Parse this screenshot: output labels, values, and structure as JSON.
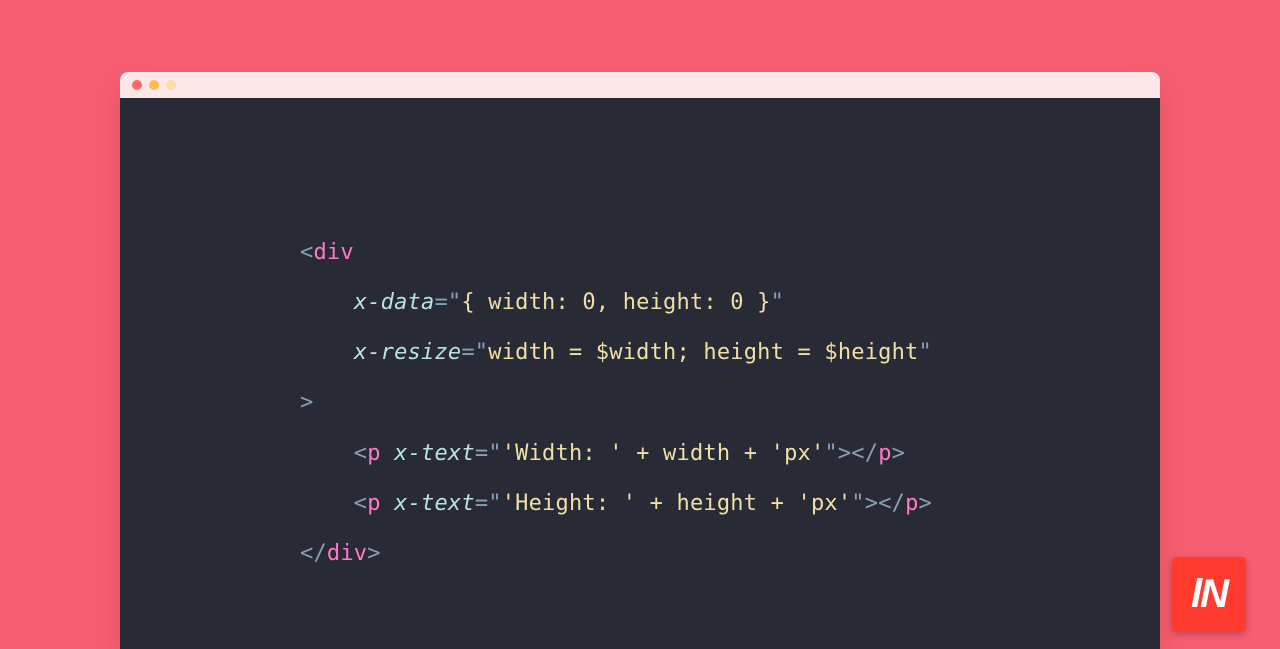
{
  "logo": {
    "text": "lN"
  },
  "code": {
    "lines": [
      {
        "tokens": [
          {
            "cls": "tok-punc",
            "t": "<"
          },
          {
            "cls": "tok-tag",
            "t": "div"
          }
        ]
      },
      {
        "indent": 1,
        "tokens": [
          {
            "cls": "tok-attr",
            "t": "x-data"
          },
          {
            "cls": "tok-eq",
            "t": "="
          },
          {
            "cls": "tok-quote",
            "t": "\""
          },
          {
            "cls": "tok-str",
            "t": "{ width: 0, height: 0 }"
          },
          {
            "cls": "tok-quote",
            "t": "\""
          }
        ]
      },
      {
        "indent": 1,
        "tokens": [
          {
            "cls": "tok-attr",
            "t": "x-resize"
          },
          {
            "cls": "tok-eq",
            "t": "="
          },
          {
            "cls": "tok-quote",
            "t": "\""
          },
          {
            "cls": "tok-str",
            "t": "width = $width; height = $height"
          },
          {
            "cls": "tok-quote",
            "t": "\""
          }
        ]
      },
      {
        "tokens": [
          {
            "cls": "tok-punc",
            "t": ">"
          }
        ]
      },
      {
        "indent": 1,
        "tokens": [
          {
            "cls": "tok-punc",
            "t": "<"
          },
          {
            "cls": "tok-tag",
            "t": "p"
          },
          {
            "cls": "",
            "t": " "
          },
          {
            "cls": "tok-attr",
            "t": "x-text"
          },
          {
            "cls": "tok-eq",
            "t": "="
          },
          {
            "cls": "tok-quote",
            "t": "\""
          },
          {
            "cls": "tok-str",
            "t": "'Width: ' + width + 'px'"
          },
          {
            "cls": "tok-quote",
            "t": "\""
          },
          {
            "cls": "tok-punc",
            "t": "></"
          },
          {
            "cls": "tok-tag",
            "t": "p"
          },
          {
            "cls": "tok-punc",
            "t": ">"
          }
        ]
      },
      {
        "indent": 1,
        "tokens": [
          {
            "cls": "tok-punc",
            "t": "<"
          },
          {
            "cls": "tok-tag",
            "t": "p"
          },
          {
            "cls": "",
            "t": " "
          },
          {
            "cls": "tok-attr",
            "t": "x-text"
          },
          {
            "cls": "tok-eq",
            "t": "="
          },
          {
            "cls": "tok-quote",
            "t": "\""
          },
          {
            "cls": "tok-str",
            "t": "'Height: ' + height + 'px'"
          },
          {
            "cls": "tok-quote",
            "t": "\""
          },
          {
            "cls": "tok-punc",
            "t": "></"
          },
          {
            "cls": "tok-tag",
            "t": "p"
          },
          {
            "cls": "tok-punc",
            "t": ">"
          }
        ]
      },
      {
        "tokens": [
          {
            "cls": "tok-punc",
            "t": "</"
          },
          {
            "cls": "tok-tag",
            "t": "div"
          },
          {
            "cls": "tok-punc",
            "t": ">"
          }
        ]
      }
    ]
  }
}
